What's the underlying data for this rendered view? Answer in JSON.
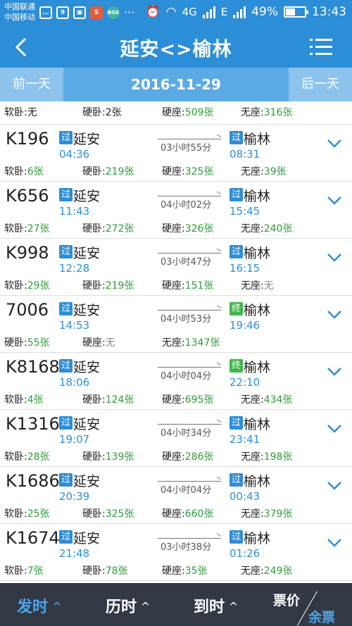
{
  "status_bar": {
    "carrier_1": "中国联通",
    "carrier_2": "中国移动",
    "notif_icons": [
      "chat-icon",
      "calendar-icon",
      "image-icon",
      "sogou-icon",
      "game-icon",
      "more-icon"
    ],
    "cal_label": "9",
    "sogou_label": "S",
    "game_label": "BOX",
    "more": "···",
    "network": "4G",
    "network2": "E",
    "battery": "49%",
    "time": "13:43"
  },
  "nav": {
    "title": "延安<>榆林"
  },
  "date_bar": {
    "prev": "前一天",
    "date": "2016-11-29",
    "next": "后一天"
  },
  "partial_row": {
    "seats": [
      {
        "label": "软卧:",
        "value": "无"
      },
      {
        "label": "硬卧:",
        "value": "2张"
      },
      {
        "label": "硬座:",
        "value": "509张"
      },
      {
        "label": "无座:",
        "value": "316张"
      }
    ]
  },
  "trains": [
    {
      "no": "K196",
      "dep_badge": "过",
      "dep_station": "延安",
      "dep_time": "04:36",
      "duration": "03小时55分",
      "arr_badge": "过",
      "arr_station": "榆林",
      "arr_time": "08:31",
      "seats": [
        {
          "label": "软卧:",
          "value": "6张"
        },
        {
          "label": "硬卧:",
          "value": "219张"
        },
        {
          "label": "硬座:",
          "value": "325张"
        },
        {
          "label": "无座:",
          "value": "39张"
        }
      ]
    },
    {
      "no": "K656",
      "dep_badge": "过",
      "dep_station": "延安",
      "dep_time": "11:43",
      "duration": "04小时02分",
      "arr_badge": "过",
      "arr_station": "榆林",
      "arr_time": "15:45",
      "seats": [
        {
          "label": "软卧:",
          "value": "27张"
        },
        {
          "label": "硬卧:",
          "value": "272张"
        },
        {
          "label": "硬座:",
          "value": "326张"
        },
        {
          "label": "无座:",
          "value": "240张"
        }
      ]
    },
    {
      "no": "K998",
      "dep_badge": "过",
      "dep_station": "延安",
      "dep_time": "12:28",
      "duration": "03小时47分",
      "arr_badge": "过",
      "arr_station": "榆林",
      "arr_time": "16:15",
      "seats": [
        {
          "label": "软卧:",
          "value": "29张"
        },
        {
          "label": "硬卧:",
          "value": "219张"
        },
        {
          "label": "硬座:",
          "value": "151张"
        },
        {
          "label": "无座:",
          "value": "无"
        }
      ]
    },
    {
      "no": "7006",
      "dep_badge": "过",
      "dep_station": "延安",
      "dep_time": "14:53",
      "duration": "04小时53分",
      "arr_badge": "终",
      "arr_station": "榆林",
      "arr_time": "19:46",
      "seats": [
        {
          "label": "硬卧:",
          "value": "55张"
        },
        {
          "label": "硬座:",
          "value": "无"
        },
        {
          "label": "无座:",
          "value": "1347张"
        }
      ]
    },
    {
      "no": "K8168",
      "dep_badge": "过",
      "dep_station": "延安",
      "dep_time": "18:06",
      "duration": "04小时04分",
      "arr_badge": "终",
      "arr_station": "榆林",
      "arr_time": "22:10",
      "seats": [
        {
          "label": "软卧:",
          "value": "4张"
        },
        {
          "label": "硬卧:",
          "value": "124张"
        },
        {
          "label": "硬座:",
          "value": "695张"
        },
        {
          "label": "无座:",
          "value": "434张"
        }
      ]
    },
    {
      "no": "K1316",
      "dep_badge": "过",
      "dep_station": "延安",
      "dep_time": "19:07",
      "duration": "04小时34分",
      "arr_badge": "过",
      "arr_station": "榆林",
      "arr_time": "23:41",
      "seats": [
        {
          "label": "软卧:",
          "value": "28张"
        },
        {
          "label": "硬卧:",
          "value": "139张"
        },
        {
          "label": "硬座:",
          "value": "286张"
        },
        {
          "label": "无座:",
          "value": "198张"
        }
      ]
    },
    {
      "no": "K1686",
      "dep_badge": "过",
      "dep_station": "延安",
      "dep_time": "20:39",
      "duration": "04小时04分",
      "arr_badge": "过",
      "arr_station": "榆林",
      "arr_time": "00:43",
      "seats": [
        {
          "label": "软卧:",
          "value": "25张"
        },
        {
          "label": "硬卧:",
          "value": "325张"
        },
        {
          "label": "硬座:",
          "value": "660张"
        },
        {
          "label": "无座:",
          "value": "379张"
        }
      ]
    },
    {
      "no": "K1674",
      "dep_badge": "过",
      "dep_station": "延安",
      "dep_time": "21:48",
      "duration": "03小时38分",
      "arr_badge": "过",
      "arr_station": "榆林",
      "arr_time": "01:26",
      "seats": [
        {
          "label": "软卧:",
          "value": "7张"
        },
        {
          "label": "硬卧:",
          "value": "78张"
        },
        {
          "label": "硬座:",
          "value": "35张"
        },
        {
          "label": "无座:",
          "value": "249张"
        }
      ]
    }
  ],
  "bottom_bar": {
    "depart": "发时",
    "duration": "历时",
    "arrive": "到时",
    "price": "票价",
    "remaining": "余票",
    "caret": "^"
  },
  "colors": {
    "brand_blue": "#2d8ed8",
    "date_bar": "#5aaae6",
    "seat_green": "#2f9a3a",
    "end_badge": "#3fb74a",
    "bottom_bar": "#333944"
  }
}
